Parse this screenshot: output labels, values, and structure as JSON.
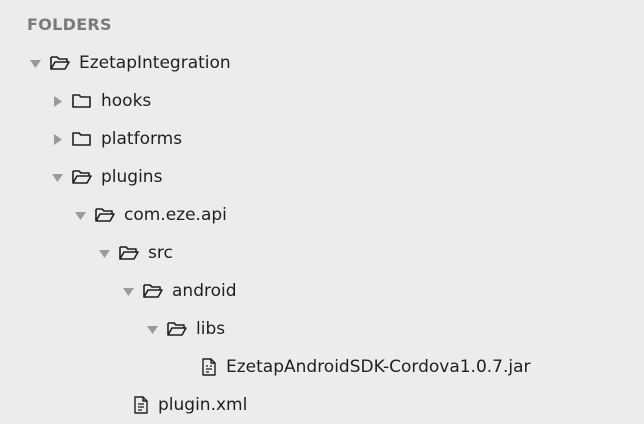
{
  "sidebar": {
    "title": "FOLDERS",
    "items": [
      {
        "label": "EzetapIntegration",
        "type": "folder",
        "expanded": true,
        "depth": 0
      },
      {
        "label": "hooks",
        "type": "folder",
        "expanded": false,
        "depth": 1
      },
      {
        "label": "platforms",
        "type": "folder",
        "expanded": false,
        "depth": 1
      },
      {
        "label": "plugins",
        "type": "folder",
        "expanded": true,
        "depth": 1
      },
      {
        "label": "com.eze.api",
        "type": "folder",
        "expanded": true,
        "depth": 2
      },
      {
        "label": "src",
        "type": "folder",
        "expanded": true,
        "depth": 3
      },
      {
        "label": "android",
        "type": "folder",
        "expanded": true,
        "depth": 4
      },
      {
        "label": "libs",
        "type": "folder",
        "expanded": true,
        "depth": 5
      },
      {
        "label": "EzetapAndroidSDK-Cordova1.0.7.jar",
        "type": "file",
        "depth": 6
      },
      {
        "label": "plugin.xml",
        "type": "file",
        "depth": 3
      }
    ]
  },
  "icons": {
    "expanded_arrow": "triangle-down-icon",
    "collapsed_arrow": "triangle-right-icon",
    "folder_open": "folder-open-icon",
    "folder_closed": "folder-icon",
    "file": "file-icon"
  },
  "colors": {
    "background": "#ececec",
    "header_text": "#7a7a7a",
    "item_text": "#1f1f1f",
    "arrow": "#9a9a9a"
  }
}
